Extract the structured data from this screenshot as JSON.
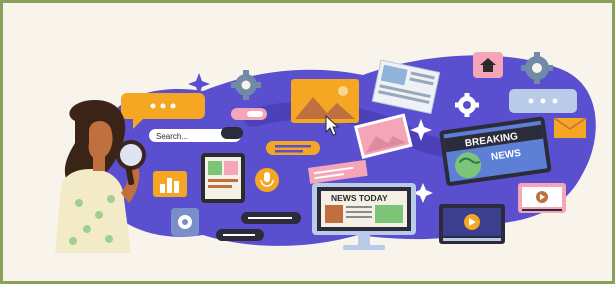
{
  "illustration": {
    "search_bar_text": "Search...",
    "tv_headline_line1": "BREAKING",
    "tv_headline_line2": "NEWS",
    "monitor_headline": "NEWS TODAY"
  },
  "icons": [
    "magnifier-icon",
    "gear-icon",
    "home-icon",
    "envelope-icon",
    "microphone-icon",
    "bar-chart-icon",
    "play-icon",
    "sparkle-icon",
    "cursor-icon",
    "image-icon"
  ],
  "colors": {
    "frame_border": "#8aa05a",
    "background": "#f8f4ec",
    "blob": "#5a4fcf",
    "blob_dark": "#4137a8",
    "accent_orange": "#f5a623",
    "accent_pink": "#f4a6b8",
    "skin": "#c0703f",
    "hair": "#3a2418"
  }
}
